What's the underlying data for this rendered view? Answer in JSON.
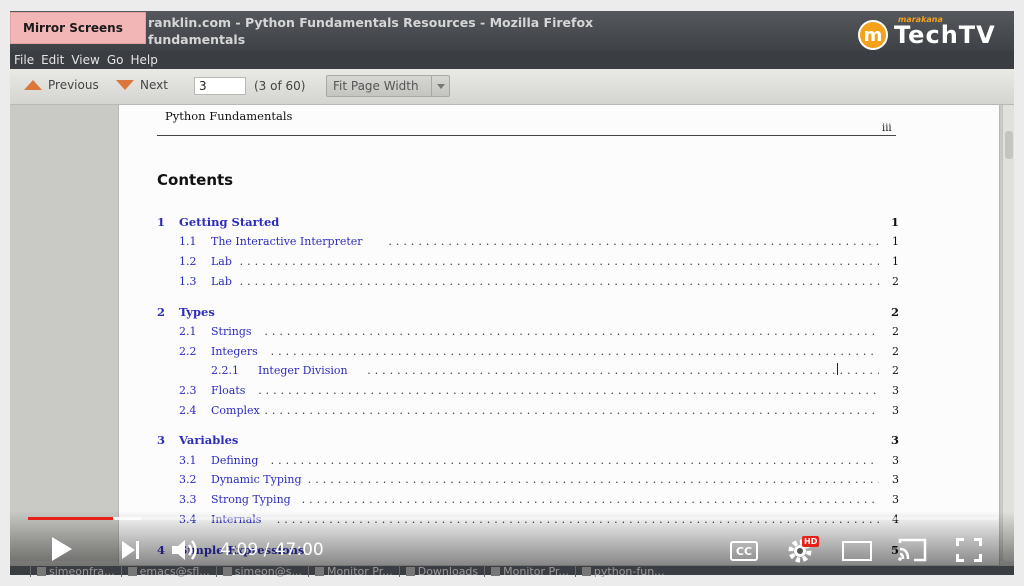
{
  "window": {
    "title_line1": "ranklin.com - Python Fundamentals Resources - Mozilla Firefox",
    "title_line2": "fundamentals"
  },
  "overlay_badge": "Mirror Screens",
  "logo": {
    "small_text": "marakana",
    "big_text": "TechTV",
    "mark": "m"
  },
  "menu": [
    "File",
    "Edit",
    "View",
    "Go",
    "Help"
  ],
  "toolbar": {
    "previous_label": "Previous",
    "next_label": "Next",
    "page_value": "3",
    "page_count": "(3 of 60)",
    "zoom_value": "Fit Page Width"
  },
  "document": {
    "running_head": "Python Fundamentals",
    "page_roman": "iii",
    "contents_heading": "Contents",
    "toc": [
      {
        "num": "1",
        "label": "Getting Started",
        "page": "1",
        "level": 0
      },
      {
        "num": "1.1",
        "label": "The Interactive Interpreter",
        "page": "1",
        "level": 1
      },
      {
        "num": "1.2",
        "label": "Lab",
        "page": "1",
        "level": 1
      },
      {
        "num": "1.3",
        "label": "Lab",
        "page": "2",
        "level": 1
      },
      {
        "num": "2",
        "label": "Types",
        "page": "2",
        "level": 0
      },
      {
        "num": "2.1",
        "label": "Strings",
        "page": "2",
        "level": 1
      },
      {
        "num": "2.2",
        "label": "Integers",
        "page": "2",
        "level": 1
      },
      {
        "num": "2.2.1",
        "label": "Integer Division",
        "page": "2",
        "level": 2
      },
      {
        "num": "2.3",
        "label": "Floats",
        "page": "3",
        "level": 1
      },
      {
        "num": "2.4",
        "label": "Complex",
        "page": "3",
        "level": 1
      },
      {
        "num": "3",
        "label": "Variables",
        "page": "3",
        "level": 0
      },
      {
        "num": "3.1",
        "label": "Defining",
        "page": "3",
        "level": 1
      },
      {
        "num": "3.2",
        "label": "Dynamic Typing",
        "page": "3",
        "level": 1
      },
      {
        "num": "3.3",
        "label": "Strong Typing",
        "page": "3",
        "level": 1
      },
      {
        "num": "3.4",
        "label": "Internals",
        "page": "4",
        "level": 1
      },
      {
        "num": "4",
        "label": "Simple Expressions",
        "page": "5",
        "level": 0
      }
    ]
  },
  "video": {
    "time": "4:09 / 47:00",
    "played_fraction": 0.088,
    "loaded_fraction": 0.116,
    "cc_label": "CC",
    "hd_label": "HD"
  },
  "taskbar": [
    "simeonfra...",
    "emacs@sfl...",
    "simeon@s...",
    "Monitor Pr...",
    "Downloads",
    "Monitor Pr...",
    "python-fun..."
  ],
  "colors": {
    "progress_played": "#e62117",
    "toc_link": "#2c2cbd",
    "logo_orange": "#f4a21c"
  }
}
